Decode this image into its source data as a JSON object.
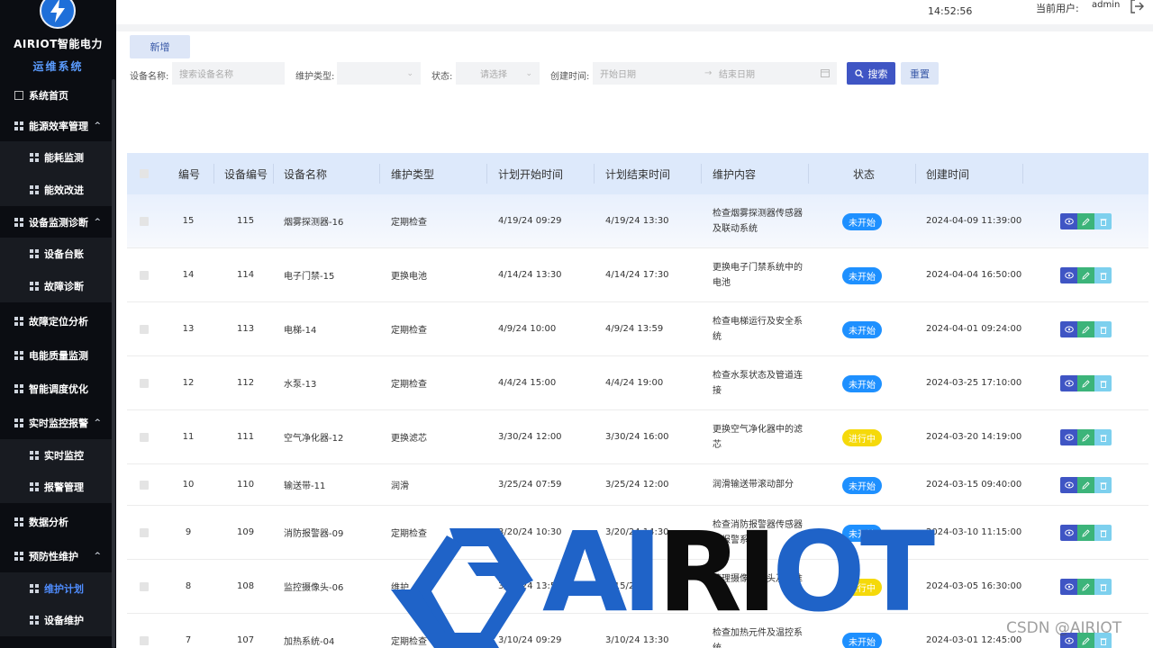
{
  "sidebar": {
    "brand": "AIRIOT智能电力",
    "brand_sub": "运维系统",
    "items": [
      {
        "label": "系统首页",
        "type": "top",
        "icon": "outline-grid-icon"
      },
      {
        "label": "能源效率管理",
        "type": "top",
        "expanded": true,
        "icon": "grid-icon"
      },
      {
        "label": "能耗监测",
        "type": "sub",
        "icon": "grid-icon"
      },
      {
        "label": "能效改进",
        "type": "sub",
        "icon": "grid-icon"
      },
      {
        "label": "设备监测诊断",
        "type": "top",
        "expanded": true,
        "icon": "grid-icon"
      },
      {
        "label": "设备台账",
        "type": "sub",
        "icon": "grid-icon"
      },
      {
        "label": "故障诊断",
        "type": "sub",
        "icon": "grid-icon"
      },
      {
        "label": "故障定位分析",
        "type": "top",
        "icon": "grid-icon"
      },
      {
        "label": "电能质量监测",
        "type": "top",
        "icon": "grid-icon"
      },
      {
        "label": "智能调度优化",
        "type": "top",
        "icon": "grid-icon"
      },
      {
        "label": "实时监控报警",
        "type": "top",
        "expanded": true,
        "icon": "grid-icon"
      },
      {
        "label": "实时监控",
        "type": "sub",
        "icon": "grid-icon"
      },
      {
        "label": "报警管理",
        "type": "sub",
        "icon": "grid-icon"
      },
      {
        "label": "数据分析",
        "type": "top",
        "icon": "grid-icon"
      },
      {
        "label": "预防性维护",
        "type": "top",
        "expanded": true,
        "icon": "grid-icon"
      },
      {
        "label": "维护计划",
        "type": "sub",
        "active": true,
        "icon": "grid-icon"
      },
      {
        "label": "设备维护",
        "type": "sub",
        "icon": "grid-icon"
      }
    ]
  },
  "header": {
    "time": "14:52:56",
    "user_label": "当前用户:",
    "user_name": "admin"
  },
  "toolbar": {
    "new_label": "新增",
    "search_label": "搜索",
    "reset_label": "重置"
  },
  "filters": {
    "device_name_label": "设备名称:",
    "device_name_placeholder": "搜索设备名称",
    "maint_type_label": "维护类型:",
    "status_label": "状态:",
    "status_placeholder": "请选择",
    "created_label": "创建时间:",
    "start_placeholder": "开始日期",
    "range_arrow": "→",
    "end_placeholder": "结束日期"
  },
  "table": {
    "columns": [
      "编号",
      "设备编号",
      "设备名称",
      "维护类型",
      "计划开始时间",
      "计划结束时间",
      "维护内容",
      "状态",
      "创建时间"
    ],
    "rows": [
      {
        "id": "15",
        "dev_no": "115",
        "name": "烟雾探测器-16",
        "type": "定期检查",
        "start": "4/19/24 09:29",
        "end": "4/19/24 13:30",
        "content1": "检查烟雾探测器传感器",
        "content2": "及联动系统",
        "status": "未开始",
        "status_color": "#1e90ff",
        "created": "2024-04-09 11:39:00"
      },
      {
        "id": "14",
        "dev_no": "114",
        "name": "电子门禁-15",
        "type": "更换电池",
        "start": "4/14/24 13:30",
        "end": "4/14/24 17:30",
        "content1": "更换电子门禁系统中的",
        "content2": "电池",
        "status": "未开始",
        "status_color": "#1e90ff",
        "created": "2024-04-04 16:50:00"
      },
      {
        "id": "13",
        "dev_no": "113",
        "name": "电梯-14",
        "type": "定期检查",
        "start": "4/9/24 10:00",
        "end": "4/9/24 13:59",
        "content1": "检查电梯运行及安全系",
        "content2": "统",
        "status": "未开始",
        "status_color": "#1e90ff",
        "created": "2024-04-01 09:24:00"
      },
      {
        "id": "12",
        "dev_no": "112",
        "name": "水泵-13",
        "type": "定期检查",
        "start": "4/4/24 15:00",
        "end": "4/4/24 19:00",
        "content1": "检查水泵状态及管道连",
        "content2": "接",
        "status": "未开始",
        "status_color": "#1e90ff",
        "created": "2024-03-25 17:10:00"
      },
      {
        "id": "11",
        "dev_no": "111",
        "name": "空气净化器-12",
        "type": "更换滤芯",
        "start": "3/30/24 12:00",
        "end": "3/30/24 16:00",
        "content1": "更换空气净化器中的滤",
        "content2": "芯",
        "status": "进行中",
        "status_color": "#f5d90a",
        "created": "2024-03-20 14:19:00"
      },
      {
        "id": "10",
        "dev_no": "110",
        "name": "输送带-11",
        "type": "润滑",
        "start": "3/25/24 07:59",
        "end": "3/25/24 12:00",
        "content1": "润滑输送带滚动部分",
        "content2": "",
        "status": "未开始",
        "status_color": "#1e90ff",
        "created": "2024-03-15 09:40:00"
      },
      {
        "id": "9",
        "dev_no": "109",
        "name": "消防报警器-09",
        "type": "定期检查",
        "start": "3/20/24 10:30",
        "end": "3/20/24 14:30",
        "content1": "检查消防报警器传感器",
        "content2": "及报警系统",
        "status": "未开始",
        "status_color": "#1e90ff",
        "created": "2024-03-10 11:15:00"
      },
      {
        "id": "8",
        "dev_no": "108",
        "name": "监控摄像头-06",
        "type": "维护",
        "start": "3/15/24 13:59",
        "end": "3/15/24",
        "content1": "清理摄像头镜头及校准",
        "content2": "位置",
        "status": "进行中",
        "status_color": "#f5d90a",
        "created": "2024-03-05 16:30:00"
      },
      {
        "id": "7",
        "dev_no": "107",
        "name": "加热系统-04",
        "type": "定期检查",
        "start": "3/10/24 09:29",
        "end": "3/10/24 13:30",
        "content1": "检查加热元件及温控系",
        "content2": "统",
        "status": "未开始",
        "status_color": "#1e90ff",
        "created": "2024-03-01 12:45:00"
      }
    ]
  },
  "watermark": {
    "text_blue1": "AI",
    "text_dark": "RI",
    "text_blue2": "OT",
    "csdn": "CSDN @AIRIOT"
  },
  "colors": {
    "primary": "#3f55c4",
    "status_blue": "#1e90ff",
    "status_yellow": "#f5d90a",
    "sidebar_bg": "#0b0d12",
    "table_header_bg": "#dde9fb"
  }
}
